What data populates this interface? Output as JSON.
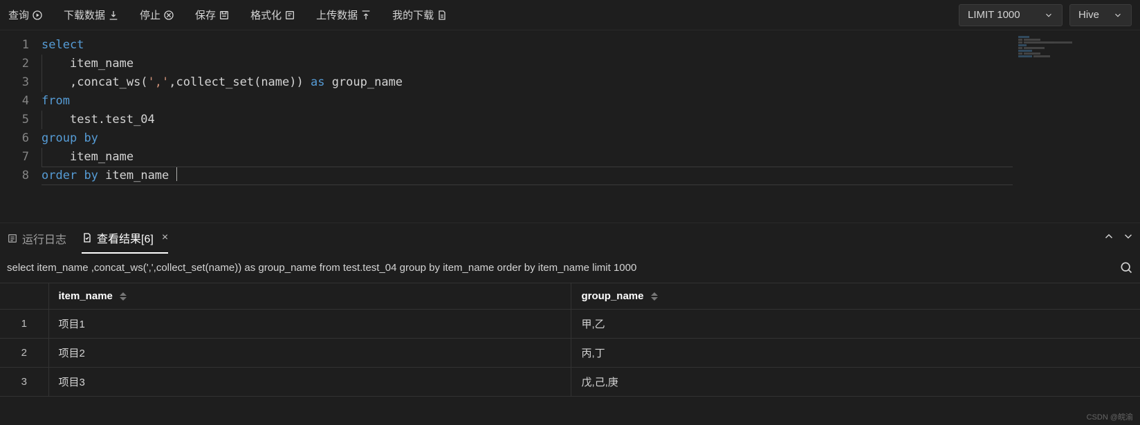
{
  "toolbar": {
    "query": "查询",
    "download": "下载数据",
    "stop": "停止",
    "save": "保存",
    "format": "格式化",
    "upload": "上传数据",
    "mydl": "我的下载",
    "limit_label": "LIMIT 1000",
    "engine_label": "Hive"
  },
  "editor": {
    "lines": [
      {
        "n": 1,
        "tokens": [
          {
            "t": "select",
            "c": "kw"
          }
        ]
      },
      {
        "n": 2,
        "tokens": [
          {
            "t": "    ",
            "c": "plain"
          },
          {
            "t": "item_name",
            "c": "plain"
          }
        ]
      },
      {
        "n": 3,
        "tokens": [
          {
            "t": "    ",
            "c": "plain"
          },
          {
            "t": ",concat_ws(",
            "c": "plain"
          },
          {
            "t": "','",
            "c": "str"
          },
          {
            "t": ",collect_set(name)) ",
            "c": "plain"
          },
          {
            "t": "as",
            "c": "kw"
          },
          {
            "t": " group_name",
            "c": "plain"
          }
        ]
      },
      {
        "n": 4,
        "tokens": [
          {
            "t": "from",
            "c": "kw"
          }
        ]
      },
      {
        "n": 5,
        "tokens": [
          {
            "t": "    ",
            "c": "plain"
          },
          {
            "t": "test.test_04",
            "c": "plain"
          }
        ]
      },
      {
        "n": 6,
        "tokens": [
          {
            "t": "group",
            "c": "kw"
          },
          {
            "t": " ",
            "c": "plain"
          },
          {
            "t": "by",
            "c": "kw"
          }
        ]
      },
      {
        "n": 7,
        "tokens": [
          {
            "t": "    ",
            "c": "plain"
          },
          {
            "t": "item_name",
            "c": "plain"
          }
        ]
      },
      {
        "n": 8,
        "tokens": [
          {
            "t": "order",
            "c": "kw"
          },
          {
            "t": " ",
            "c": "plain"
          },
          {
            "t": "by",
            "c": "kw"
          },
          {
            "t": " item_name ",
            "c": "plain"
          }
        ]
      }
    ],
    "cursor_line": 8
  },
  "panel": {
    "log_tab": "运行日志",
    "result_tab": "查看结果[6]",
    "query_display": "select item_name ,concat_ws(',',collect_set(name)) as group_name from test.test_04 group by item_name order by item_name limit 1000"
  },
  "table": {
    "columns": [
      "item_name",
      "group_name"
    ],
    "rows": [
      {
        "n": 1,
        "cells": [
          "项目1",
          "甲,乙"
        ]
      },
      {
        "n": 2,
        "cells": [
          "项目2",
          "丙,丁"
        ]
      },
      {
        "n": 3,
        "cells": [
          "项目3",
          "戊,己,庚"
        ]
      }
    ]
  },
  "watermark": "CSDN @皖渝"
}
